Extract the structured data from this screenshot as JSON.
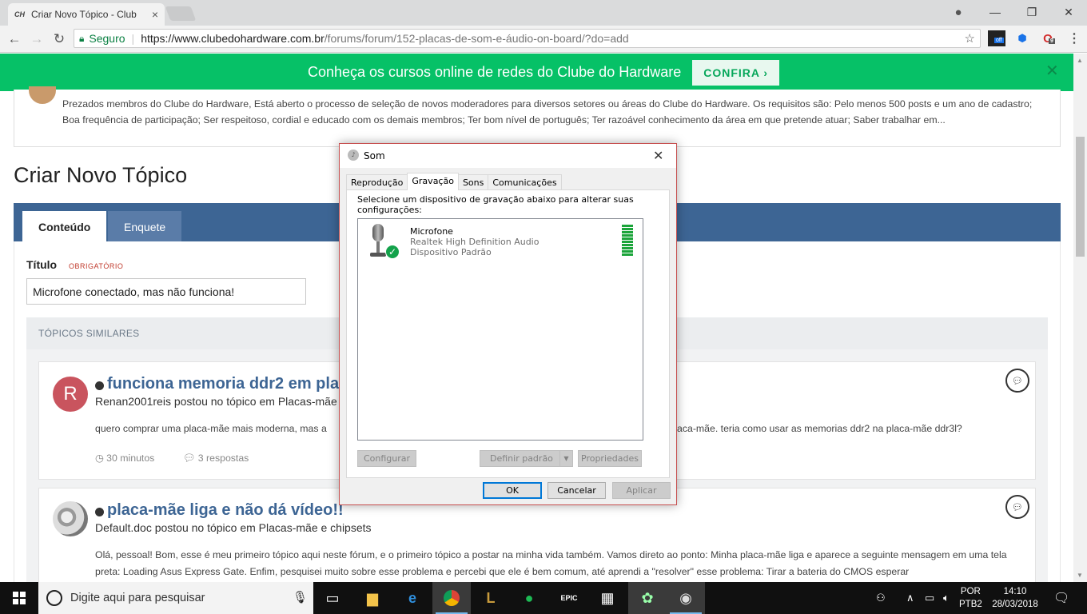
{
  "browser": {
    "tab_title": "Criar Novo Tópico - Club",
    "tab_favicon": "CH",
    "secure_label": "Seguro",
    "url_host": "https://www.clubedohardware.com.br",
    "url_path": "/forums/forum/152-placas-de-som-e-áudio-on-board/?do=add",
    "ext_badge_off": "off",
    "ext_badge_count": "9"
  },
  "banner": {
    "message": "Conheça os cursos online de redes do Clube do Hardware",
    "cta": "CONFIRA ›",
    "close": "✕"
  },
  "announcement": {
    "text": "Prezados membros do Clube do Hardware, Está aberto o processo de seleção de novos moderadores para diversos setores ou áreas do Clube do Hardware. Os requisitos são:   Pelo menos 500 posts e um ano de cadastro; Boa frequência de participação; Ser respeitoso, cordial e educado com os demais membros; Ter bom nível de português; Ter razoável conhecimento da área em que pretende atuar; Saber trabalhar em..."
  },
  "page": {
    "title": "Criar Novo Tópico",
    "tabs": [
      "Conteúdo",
      "Enquete"
    ],
    "field_label": "Título",
    "required_label": "OBRIGATÓRIO",
    "title_value": "Microfone conectado, mas não funciona!",
    "similar_header": "TÓPICOS SIMILARES"
  },
  "topics": [
    {
      "avatar_letter": "R",
      "title": "funciona memoria ddr2 em pla",
      "subtitle": "Renan2001reis postou no tópico em Placas-mãe",
      "excerpt_left": "quero comprar uma placa-mãe mais moderna, mas a",
      "excerpt_right": "aca-mãe. teria como usar as memorias ddr2 na placa-mãe ddr3l?",
      "time": "30 minutos",
      "replies": "3 respostas"
    },
    {
      "title": "placa-mãe liga e não dá vídeo!!",
      "subtitle": "Default.doc postou no tópico em Placas-mãe e chipsets",
      "excerpt": "Olá, pessoal! Bom, esse é meu primeiro tópico aqui neste fórum, e o primeiro tópico a postar na minha vida também. Vamos direto ao ponto: Minha placa-mãe liga e aparece a seguinte mensagem em uma tela preta: Loading Asus Express Gate. Enfim, pesquisei muito sobre esse problema e percebi que ele é bem comum, até aprendi a \"resolver\" esse problema: Tirar a bateria do CMOS esperar"
    }
  ],
  "dialog": {
    "title": "Som",
    "tabs": [
      "Reprodução",
      "Gravação",
      "Sons",
      "Comunicações"
    ],
    "active_tab": "Gravação",
    "instruction": "Selecione um dispositivo de gravação abaixo para alterar suas configurações:",
    "device": {
      "name": "Microfone",
      "driver": "Realtek High Definition Audio",
      "status": "Dispositivo Padrão"
    },
    "buttons": {
      "configure": "Configurar",
      "set_default": "Definir padrão",
      "properties": "Propriedades",
      "ok": "OK",
      "cancel": "Cancelar",
      "apply": "Aplicar"
    }
  },
  "taskbar": {
    "search_placeholder": "Digite aqui para pesquisar",
    "lang_top": "POR",
    "lang_bottom": "PTB2",
    "time": "14:10",
    "date": "28/03/2018"
  }
}
